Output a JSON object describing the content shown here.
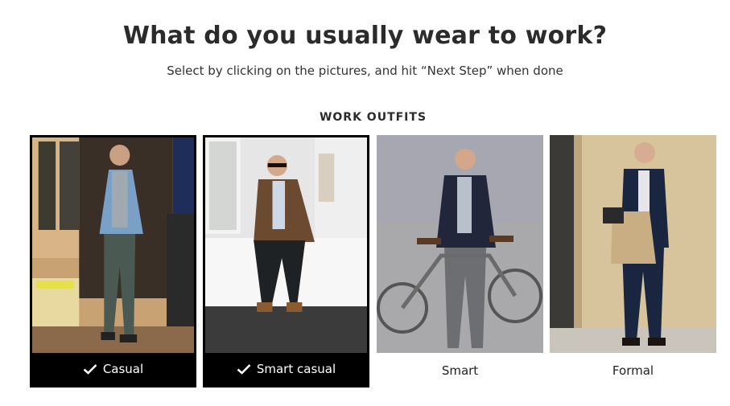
{
  "header": {
    "title": "What do you usually wear to work?",
    "subtitle": "Select by clicking on the pictures, and hit “Next Step” when done"
  },
  "section": {
    "title": "WORK OUTFITS"
  },
  "outfits": [
    {
      "label": "Casual",
      "selected": true,
      "icon": "check-icon"
    },
    {
      "label": "Smart casual",
      "selected": true,
      "icon": "check-icon"
    },
    {
      "label": "Smart",
      "selected": false
    },
    {
      "label": "Formal",
      "selected": false
    }
  ],
  "colors": {
    "selected_border": "#000000",
    "selected_label_bg": "#000000",
    "selected_label_text": "#ffffff"
  }
}
